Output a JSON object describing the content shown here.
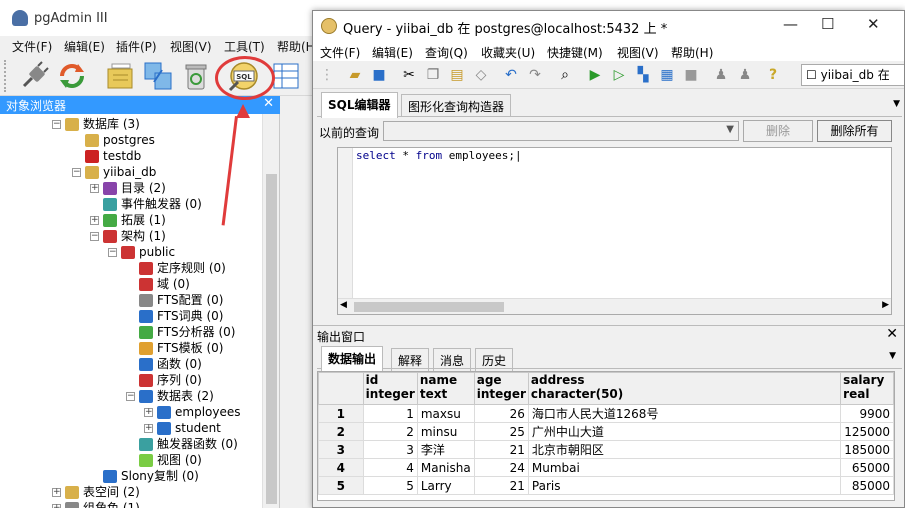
{
  "main_window": {
    "title": "pgAdmin III",
    "menu": [
      "文件(F)",
      "编辑(E)",
      "插件(P)",
      "视图(V)",
      "工具(T)",
      "帮助(H)"
    ],
    "browser_title": "对象浏览器",
    "tree": [
      {
        "label": "数据库 (3)",
        "expander": "−",
        "icon_color": "#d8b04a"
      },
      {
        "label": "postgres",
        "expander": "",
        "icon_color": "#d8b04a"
      },
      {
        "label": "testdb",
        "expander": "",
        "icon_color": "#cc2222"
      },
      {
        "label": "yiibai_db",
        "expander": "−",
        "icon_color": "#d8b04a"
      },
      {
        "label": "目录 (2)",
        "expander": "+",
        "icon_color": "#8844aa"
      },
      {
        "label": "事件触发器 (0)",
        "expander": "",
        "icon_color": "#3aa0a0"
      },
      {
        "label": "拓展 (1)",
        "expander": "+",
        "icon_color": "#44aa44"
      },
      {
        "label": "架构 (1)",
        "expander": "−",
        "icon_color": "#cc3333"
      },
      {
        "label": "public",
        "expander": "−",
        "icon_color": "#cc3333"
      },
      {
        "label": "定序规则 (0)",
        "expander": "",
        "icon_color": "#cc3333"
      },
      {
        "label": "域 (0)",
        "expander": "",
        "icon_color": "#cc3333"
      },
      {
        "label": "FTS配置 (0)",
        "expander": "",
        "icon_color": "#888888"
      },
      {
        "label": "FTS词典 (0)",
        "expander": "",
        "icon_color": "#2a6fc9"
      },
      {
        "label": "FTS分析器 (0)",
        "expander": "",
        "icon_color": "#44aa44"
      },
      {
        "label": "FTS模板 (0)",
        "expander": "",
        "icon_color": "#e0a030"
      },
      {
        "label": "函数 (0)",
        "expander": "",
        "icon_color": "#2a6fc9"
      },
      {
        "label": "序列 (0)",
        "expander": "",
        "icon_color": "#cc3333"
      },
      {
        "label": "数据表 (2)",
        "expander": "−",
        "icon_color": "#2a6fc9"
      },
      {
        "label": "employees",
        "expander": "+",
        "icon_color": "#2a6fc9"
      },
      {
        "label": "student",
        "expander": "+",
        "icon_color": "#2a6fc9"
      },
      {
        "label": "触发器函数 (0)",
        "expander": "",
        "icon_color": "#3aa0a0"
      },
      {
        "label": "视图 (0)",
        "expander": "",
        "icon_color": "#7acc44"
      },
      {
        "label": "Slony复制 (0)",
        "expander": "",
        "icon_color": "#2a6fc9"
      },
      {
        "label": "表空间 (2)",
        "expander": "+",
        "icon_color": "#d8b04a"
      },
      {
        "label": "组角色 (1)",
        "expander": "+",
        "icon_color": "#888888"
      }
    ]
  },
  "query_window": {
    "title": "Query - yiibai_db 在 postgres@localhost:5432 上 *",
    "menu": [
      "文件(F)",
      "编辑(E)",
      "查询(Q)",
      "收藏夹(U)",
      "快捷键(M)",
      "视图(V)",
      "帮助(H)"
    ],
    "db_select": "yiibai_db 在",
    "tabs": [
      "SQL编辑器",
      "图形化查询构造器"
    ],
    "previous_query_label": "以前的查询",
    "delete_button": "删除",
    "delete_all_button": "删除所有",
    "sql_keyword1": "select",
    "sql_middle": " * ",
    "sql_keyword2": "from",
    "sql_rest": " employees;",
    "output_title": "输出窗口",
    "output_tabs": [
      "数据输出",
      "解释",
      "消息",
      "历史"
    ],
    "columns": [
      {
        "name": "id",
        "type": "integer"
      },
      {
        "name": "name",
        "type": "text"
      },
      {
        "name": "age",
        "type": "integer"
      },
      {
        "name": "address",
        "type": "character(50)"
      },
      {
        "name": "salary",
        "type": "real"
      }
    ],
    "rows": [
      {
        "n": "1",
        "id": "1",
        "name": "maxsu",
        "age": "26",
        "address": "海口市人民大道1268号",
        "salary": "9900"
      },
      {
        "n": "2",
        "id": "2",
        "name": "minsu",
        "age": "25",
        "address": "广州中山大道",
        "salary": "125000"
      },
      {
        "n": "3",
        "id": "3",
        "name": "李洋",
        "age": "21",
        "address": "北京市朝阳区",
        "salary": "185000"
      },
      {
        "n": "4",
        "id": "4",
        "name": "Manisha",
        "age": "24",
        "address": "Mumbai",
        "salary": "65000"
      },
      {
        "n": "5",
        "id": "5",
        "name": "Larry",
        "age": "21",
        "address": "Paris",
        "salary": "85000"
      }
    ]
  }
}
